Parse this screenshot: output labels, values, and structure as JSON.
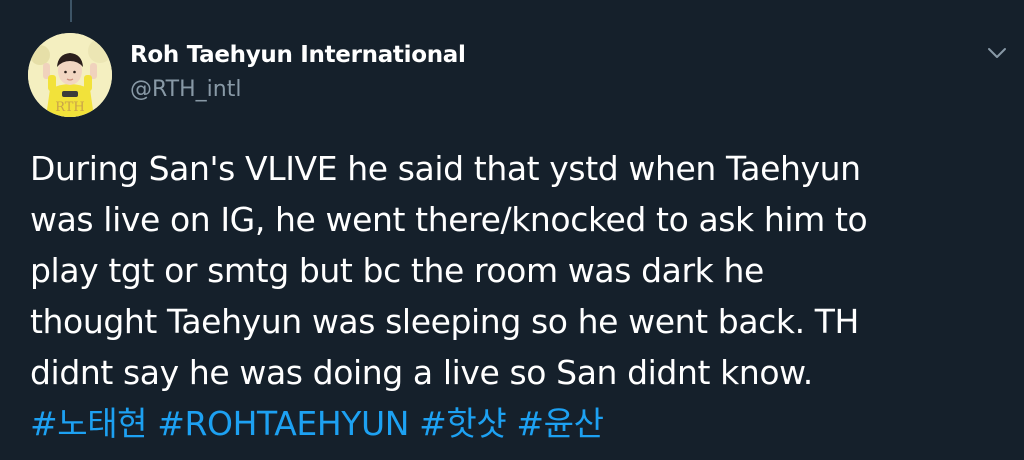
{
  "author": {
    "display_name": "Roh Taehyun International",
    "handle": "@RTH_intl",
    "avatar_text": "RTH"
  },
  "tweet": {
    "lines": [
      "During San's VLIVE he said that ystd when Taehyun",
      "was live on IG, he went there/knocked to ask him to",
      "play tgt or smtg but bc the room was dark he",
      "thought Taehyun was sleeping so he went back. TH",
      "didnt say he was doing a live so San didnt know."
    ],
    "hashtags": [
      "#노태현",
      "#ROHTAEHYUN",
      "#핫샷",
      "#윤산"
    ]
  },
  "icons": {
    "menu": "chevron-down-icon",
    "avatar": "profile-photo"
  },
  "colors": {
    "background": "#15202b",
    "text": "#ffffff",
    "secondary": "#8899a6",
    "link": "#1da1f2"
  }
}
